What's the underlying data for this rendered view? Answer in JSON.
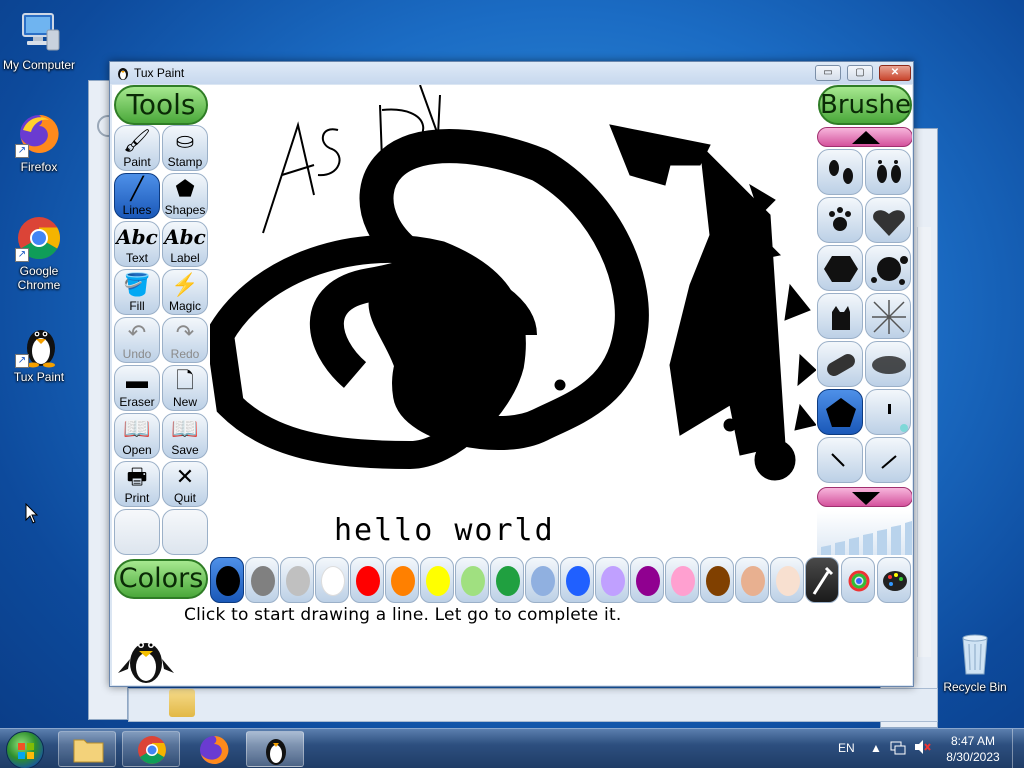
{
  "desktop": {
    "icons": [
      {
        "label": "My Computer"
      },
      {
        "label": "Firefox"
      },
      {
        "label": "Google Chrome"
      },
      {
        "label": "Tux Paint"
      },
      {
        "label": "Recycle Bin"
      }
    ]
  },
  "window": {
    "title": "Tux Paint",
    "minimize": "▭",
    "maximize": "▢",
    "close": "✕"
  },
  "tools": {
    "header": "Tools",
    "items": [
      {
        "label": "Paint",
        "icon": "paint-brush-icon",
        "glyph": "🖌"
      },
      {
        "label": "Stamp",
        "icon": "stamp-icon",
        "glyph": "⛀"
      },
      {
        "label": "Lines",
        "icon": "lines-icon",
        "glyph": "╱",
        "selected": true
      },
      {
        "label": "Shapes",
        "icon": "pentagon-icon",
        "glyph": "⬟"
      },
      {
        "label": "Text",
        "icon": "text-icon",
        "glyph": "Abc"
      },
      {
        "label": "Label",
        "icon": "label-icon",
        "glyph": "Abc"
      },
      {
        "label": "Fill",
        "icon": "paint-bucket-icon",
        "glyph": "🪣"
      },
      {
        "label": "Magic",
        "icon": "magic-wand-icon",
        "glyph": "⚡"
      },
      {
        "label": "Undo",
        "icon": "undo-icon",
        "glyph": "↶",
        "disabled": true
      },
      {
        "label": "Redo",
        "icon": "redo-icon",
        "glyph": "↷",
        "disabled": true
      },
      {
        "label": "Eraser",
        "icon": "eraser-icon",
        "glyph": "▬"
      },
      {
        "label": "New",
        "icon": "new-page-icon",
        "glyph": "🗋"
      },
      {
        "label": "Open",
        "icon": "open-book-icon",
        "glyph": "📖"
      },
      {
        "label": "Save",
        "icon": "save-book-icon",
        "glyph": "📖"
      },
      {
        "label": "Print",
        "icon": "printer-icon",
        "glyph": "🖶"
      },
      {
        "label": "Quit",
        "icon": "quit-icon",
        "glyph": "✕"
      }
    ]
  },
  "canvas": {
    "text": "hello world",
    "scribble": "ASD"
  },
  "brushes": {
    "header": "Brushes",
    "items": [
      {
        "icon": "footprints-icon"
      },
      {
        "icon": "bare-feet-icon"
      },
      {
        "icon": "paw-prints-icon"
      },
      {
        "icon": "heart-icon"
      },
      {
        "icon": "hexagon-icon"
      },
      {
        "icon": "splat-icon"
      },
      {
        "icon": "cat-icon"
      },
      {
        "icon": "net-icon"
      },
      {
        "icon": "slanted-brush-icon"
      },
      {
        "icon": "blur-ellipse-icon"
      },
      {
        "icon": "pentagon-icon",
        "selected": true
      },
      {
        "icon": "sparkle-icon"
      },
      {
        "icon": "short-line-icon"
      },
      {
        "icon": "diagonal-line-icon"
      }
    ]
  },
  "colors": {
    "header": "Colors",
    "swatches": [
      {
        "name": "black",
        "hex": "#000000",
        "selected": true
      },
      {
        "name": "dark-gray",
        "hex": "#808080"
      },
      {
        "name": "light-gray",
        "hex": "#c0c0c0"
      },
      {
        "name": "white",
        "hex": "#ffffff"
      },
      {
        "name": "red",
        "hex": "#ff0000"
      },
      {
        "name": "orange",
        "hex": "#ff8000"
      },
      {
        "name": "yellow",
        "hex": "#ffff00"
      },
      {
        "name": "light-green",
        "hex": "#a0e080"
      },
      {
        "name": "green",
        "hex": "#20a040"
      },
      {
        "name": "sky-blue",
        "hex": "#90b0e0"
      },
      {
        "name": "blue",
        "hex": "#2060ff"
      },
      {
        "name": "lavender",
        "hex": "#c0a0ff"
      },
      {
        "name": "purple",
        "hex": "#900090"
      },
      {
        "name": "pink",
        "hex": "#ffa0d0"
      },
      {
        "name": "brown",
        "hex": "#804000"
      },
      {
        "name": "tan",
        "hex": "#e8b090"
      },
      {
        "name": "beige",
        "hex": "#f8e0d0"
      }
    ]
  },
  "status": {
    "message": "Click to start drawing a line. Let go to complete it."
  },
  "taskbar": {
    "language": "EN",
    "time": "8:47 AM",
    "date": "8/30/2023"
  }
}
